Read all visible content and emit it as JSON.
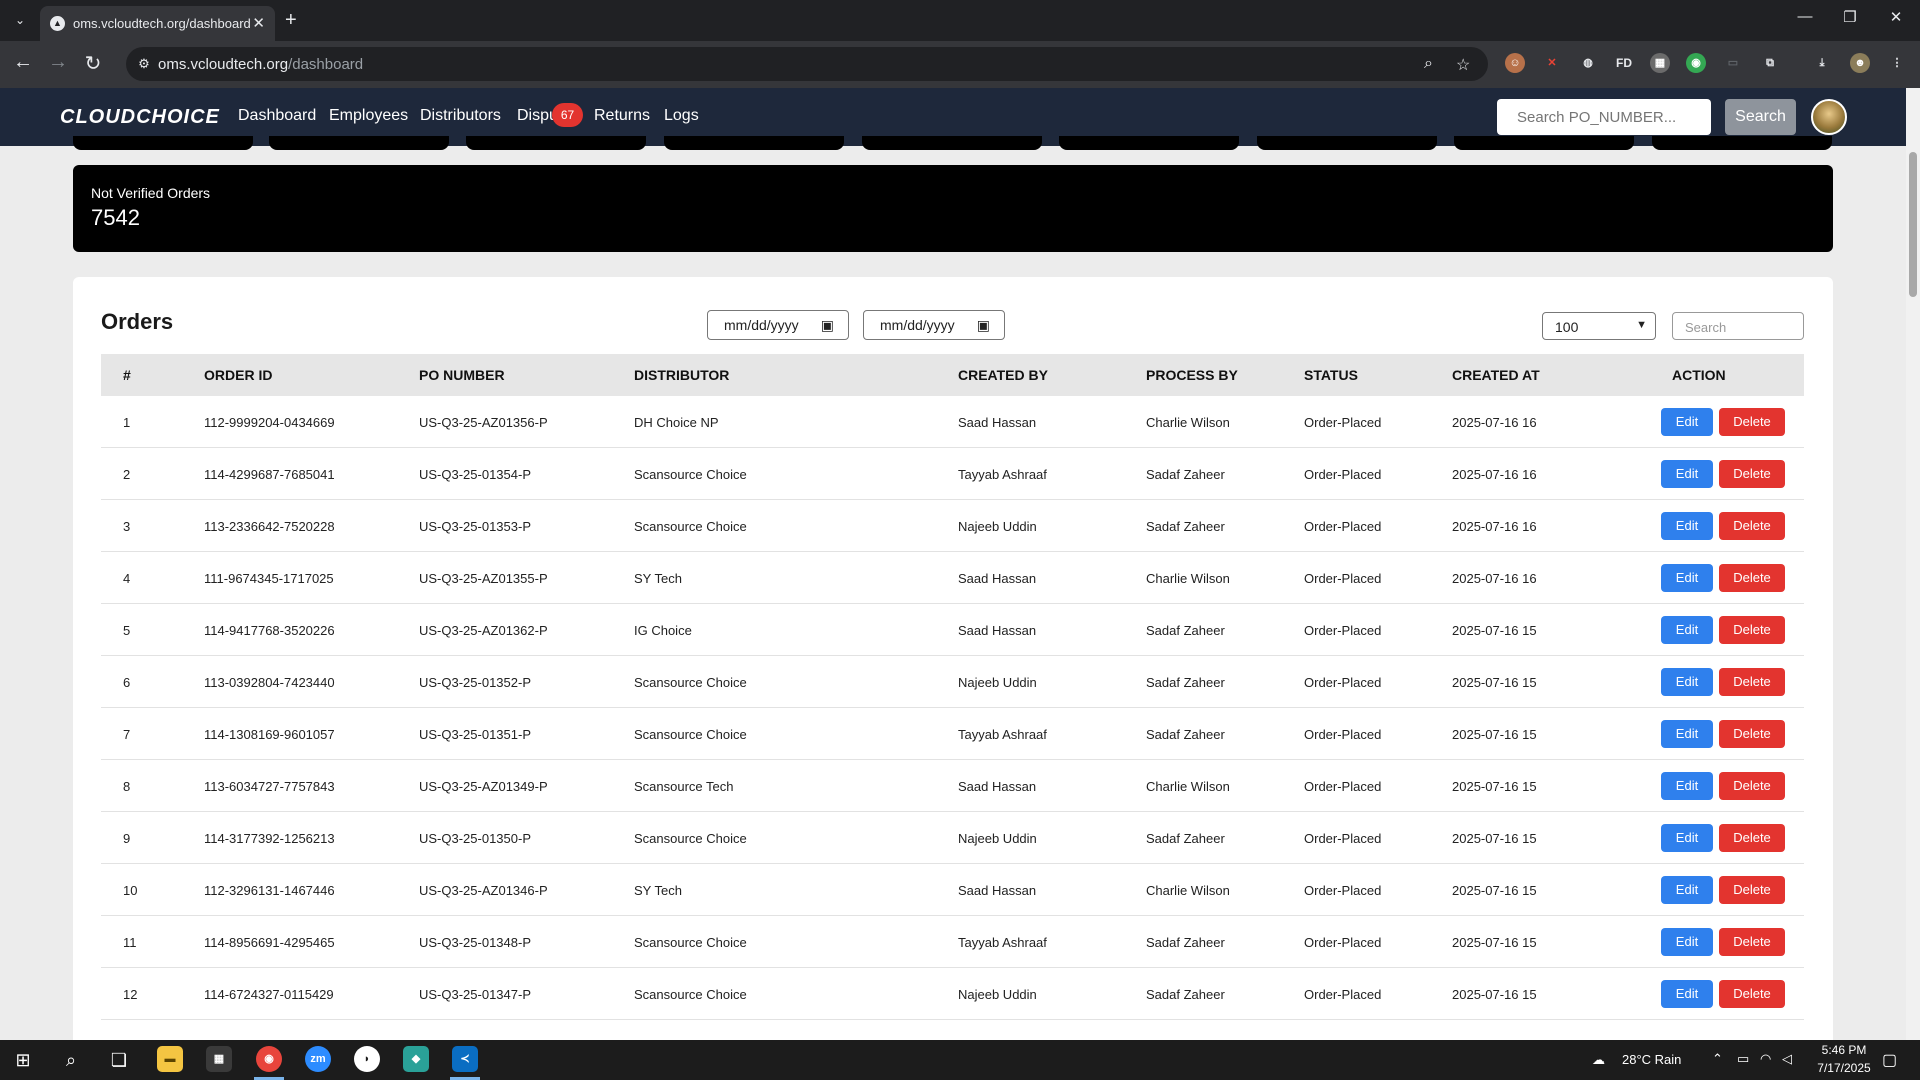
{
  "browser": {
    "tab_title": "oms.vcloudtech.org/dashboard",
    "url_host": "oms.vcloudtech.org",
    "url_path": "/dashboard"
  },
  "navbar": {
    "logo": "CLOUDCHOICE",
    "links": [
      "Dashboard",
      "Employees",
      "Distributors",
      "Dispu",
      "Returns",
      "Logs"
    ],
    "disputes_badge": "67",
    "search_placeholder": "Search PO_NUMBER...",
    "search_button": "Search"
  },
  "summary": {
    "label": "Not Verified Orders",
    "value": "7542"
  },
  "orders": {
    "title": "Orders",
    "date_from_placeholder": "mm/dd/yyyy",
    "date_to_placeholder": "mm/dd/yyyy",
    "page_size": "100",
    "search_placeholder": "Search",
    "columns": [
      "#",
      "ORDER ID",
      "PO NUMBER",
      "DISTRIBUTOR",
      "CREATED BY",
      "PROCESS BY",
      "STATUS",
      "CREATED AT",
      "ACTION"
    ],
    "edit_label": "Edit",
    "delete_label": "Delete",
    "rows": [
      [
        "1",
        "112-9999204-0434669",
        "US-Q3-25-AZ01356-P",
        "DH Choice NP",
        "Saad Hassan",
        "Charlie Wilson",
        "Order-Placed",
        "2025-07-16 16"
      ],
      [
        "2",
        "114-4299687-7685041",
        "US-Q3-25-01354-P",
        "Scansource Choice",
        "Tayyab Ashraaf",
        "Sadaf Zaheer",
        "Order-Placed",
        "2025-07-16 16"
      ],
      [
        "3",
        "113-2336642-7520228",
        "US-Q3-25-01353-P",
        "Scansource Choice",
        "Najeeb Uddin",
        "Sadaf Zaheer",
        "Order-Placed",
        "2025-07-16 16"
      ],
      [
        "4",
        "111-9674345-1717025",
        "US-Q3-25-AZ01355-P",
        "SY Tech",
        "Saad Hassan",
        "Charlie Wilson",
        "Order-Placed",
        "2025-07-16 16"
      ],
      [
        "5",
        "114-9417768-3520226",
        "US-Q3-25-AZ01362-P",
        "IG Choice",
        "Saad Hassan",
        "Sadaf Zaheer",
        "Order-Placed",
        "2025-07-16 15"
      ],
      [
        "6",
        "113-0392804-7423440",
        "US-Q3-25-01352-P",
        "Scansource Choice",
        "Najeeb Uddin",
        "Sadaf Zaheer",
        "Order-Placed",
        "2025-07-16 15"
      ],
      [
        "7",
        "114-1308169-9601057",
        "US-Q3-25-01351-P",
        "Scansource Choice",
        "Tayyab Ashraaf",
        "Sadaf Zaheer",
        "Order-Placed",
        "2025-07-16 15"
      ],
      [
        "8",
        "113-6034727-7757843",
        "US-Q3-25-AZ01349-P",
        "Scansource Tech",
        "Saad Hassan",
        "Charlie Wilson",
        "Order-Placed",
        "2025-07-16 15"
      ],
      [
        "9",
        "114-3177392-1256213",
        "US-Q3-25-01350-P",
        "Scansource Choice",
        "Najeeb Uddin",
        "Sadaf Zaheer",
        "Order-Placed",
        "2025-07-16 15"
      ],
      [
        "10",
        "112-3296131-1467446",
        "US-Q3-25-AZ01346-P",
        "SY Tech",
        "Saad Hassan",
        "Charlie Wilson",
        "Order-Placed",
        "2025-07-16 15"
      ],
      [
        "11",
        "114-8956691-4295465",
        "US-Q3-25-01348-P",
        "Scansource Choice",
        "Tayyab Ashraaf",
        "Sadaf Zaheer",
        "Order-Placed",
        "2025-07-16 15"
      ],
      [
        "12",
        "114-6724327-0115429",
        "US-Q3-25-01347-P",
        "Scansource Choice",
        "Najeeb Uddin",
        "Sadaf Zaheer",
        "Order-Placed",
        "2025-07-16 15"
      ]
    ]
  },
  "taskbar": {
    "weather": "28°C  Rain",
    "time": "5:46 PM",
    "date": "7/17/2025"
  },
  "icons": {
    "colors": {
      "navbar": "#1e283b",
      "edit": "#2f80ed",
      "delete": "#e3342f",
      "badge": "#e3342f"
    }
  }
}
